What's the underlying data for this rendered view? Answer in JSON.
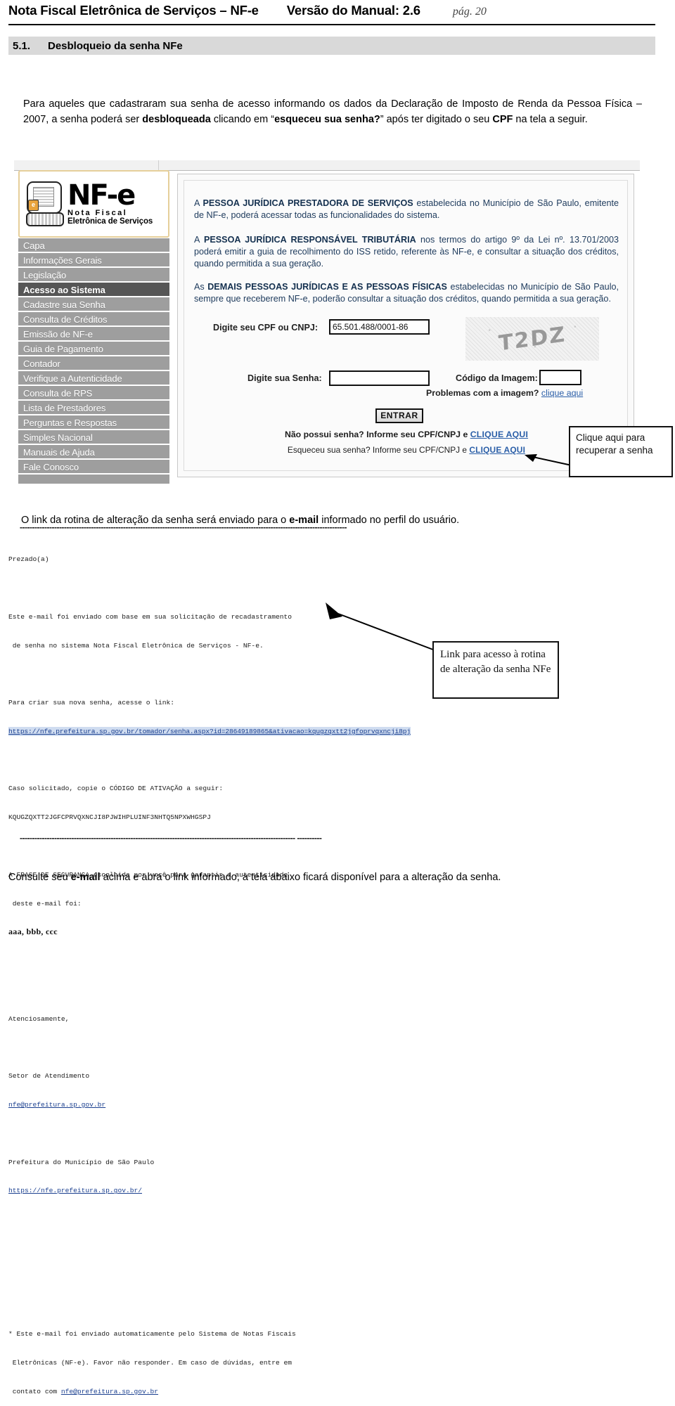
{
  "header": {
    "title": "Nota Fiscal Eletrônica de Serviços – NF-e",
    "version": "Versão do Manual: 2.6",
    "page": "pág. 20"
  },
  "section": {
    "number": "5.1.",
    "title": "Desbloqueio da senha NFe"
  },
  "intro": {
    "part1": "Para aqueles que cadastraram sua senha de acesso informando os dados da Declaração de Imposto de Renda da Pessoa Física – 2007, a senha poderá ser ",
    "bold1": "desbloqueada",
    "part2": " clicando em “",
    "bold2": "esqueceu sua senha?",
    "part3": "” após ter digitado o seu ",
    "bold3": "CPF",
    "part4": " na tela a seguir."
  },
  "nfe_screen": {
    "logo": {
      "mark": "NF-e",
      "line1": "Nota Fiscal",
      "line2": "Eletrônica de Serviços",
      "badge_letter": "e"
    },
    "menu": [
      "Capa",
      "Informações Gerais",
      "Legislação",
      "Acesso ao Sistema",
      "Cadastre sua Senha",
      "Consulta de Créditos",
      "Emissão de NF-e",
      "Guia de Pagamento",
      "Contador",
      "Verifique a Autenticidade",
      "Consulta de RPS",
      "Lista de Prestadores",
      "Perguntas e Respostas",
      "Simples Nacional",
      "Manuais de Ajuda",
      "Fale Conosco"
    ],
    "active_menu_index": 3,
    "blurbs": {
      "b1_bold": "PESSOA JURÍDICA PRESTADORA DE SERVIÇOS",
      "b1_pre": "A ",
      "b1_rest": " estabelecida no Município de São Paulo, emitente de NF-e, poderá acessar todas as funcionalidades do sistema.",
      "b2_pre": "A ",
      "b2_bold": "PESSOA JURÍDICA RESPONSÁVEL TRIBUTÁRIA",
      "b2_rest": " nos termos do artigo 9º da Lei nº. 13.701/2003 poderá emitir a guia de recolhimento do ISS retido, referente às NF-e, e consultar a situação dos créditos, quando permitida a sua geração.",
      "b3_pre": "As ",
      "b3_bold": "DEMAIS PESSOAS JURÍDICAS E AS PESSOAS FÍSICAS",
      "b3_rest": " estabelecidas no Município de São Paulo, sempre que receberem NF-e, poderão consultar a situação dos créditos, quando permitida a sua geração."
    },
    "form": {
      "cpf_label": "Digite seu CPF ou CNPJ:",
      "cpf_value": "65.501.488/0001-86",
      "senha_label": "Digite sua Senha:",
      "senha_value": "",
      "codigo_label": "Código da Imagem:",
      "codigo_value": "",
      "captcha_text": "T2DZ",
      "problema_text": "Problemas com a imagem? ",
      "problema_link": "clique aqui",
      "entrar_button": "ENTRAR",
      "nao_possui_text": "Não possui senha? Informe seu CPF/CNPJ e ",
      "nao_possui_link": "CLIQUE AQUI",
      "esqueceu_text": "Esqueceu sua senha? Informe seu CPF/CNPJ e ",
      "esqueceu_link": "CLIQUE AQUI"
    }
  },
  "callouts": {
    "one": "Clique aqui para recuperar a senha",
    "two": "Link para acesso à rotina de alteração da senha NFe"
  },
  "mid_sentence": {
    "part1": "O link da rotina de alteração da senha será enviado para o ",
    "bold": "e-mail",
    "part2": " informado no perfil do usuário."
  },
  "dash_rule_1": "-------------------------------------------------------------------------------------------------------------------------------------",
  "dash_rule_2": "---------------------------------------------------------------------------------------------------------------- ----------",
  "email": {
    "greeting": "Prezado(a)",
    "l1": "Este e-mail foi enviado com base em sua solicitação de recadastramento",
    "l2": " de senha no sistema Nota Fiscal Eletrônica de Serviços - NF-e.",
    "l3": "Para criar sua nova senha, acesse o link:",
    "url": "https://nfe.prefeitura.sp.gov.br/tomador/senha.aspx?id=28649189865&ativacao=kqugzqxtt2jgfoprvqxncji8pj",
    "l4": "Caso solicitado, copie o CÓDIGO DE ATIVAÇÃO a seguir:",
    "activation_code": "KQUGZQXTT2JGFCPRVQXNCJI8PJWIHPLUINF3NHTQ5NPXWHGSPJ",
    "l5": "A FRASE DE SEGURANÇA escolhida por você para garantir a autenticidade",
    "l6": " deste e-mail foi:",
    "security_phrase": "aaa, bbb, ccc",
    "l7": "Atenciosamente,",
    "l8": "Setor de Atendimento",
    "support_email": "nfe@prefeitura.sp.gov.br",
    "l9": "Prefeitura do Município de São Paulo",
    "site_url": "https://nfe.prefeitura.sp.gov.br/",
    "l10": "* Este e-mail foi enviado automaticamente pelo Sistema de Notas Fiscais",
    "l11": " Eletrônicas (NF-e). Favor não responder. Em caso de dúvidas, entre em",
    "l12_pre": " contato com ",
    "l12_link": "nfe@prefeitura.sp.gov.br"
  },
  "footer_sentence": {
    "part1": "Consulte seu ",
    "bold": "e-mail",
    "part2": " acima e abra o link informado,  a tela abaixo ficará disponível para a alteração da senha."
  },
  "colors": {
    "section_bar": "#d9d9d9",
    "menu_bg": "#9e9e9e",
    "menu_active_bg": "#565656",
    "blurb_text": "#1d3a5c",
    "link": "#2b5fa8",
    "email_link": "#1a3f8f",
    "url_highlight": "#cfdcf0",
    "logo_border": "#e6cf9a"
  }
}
